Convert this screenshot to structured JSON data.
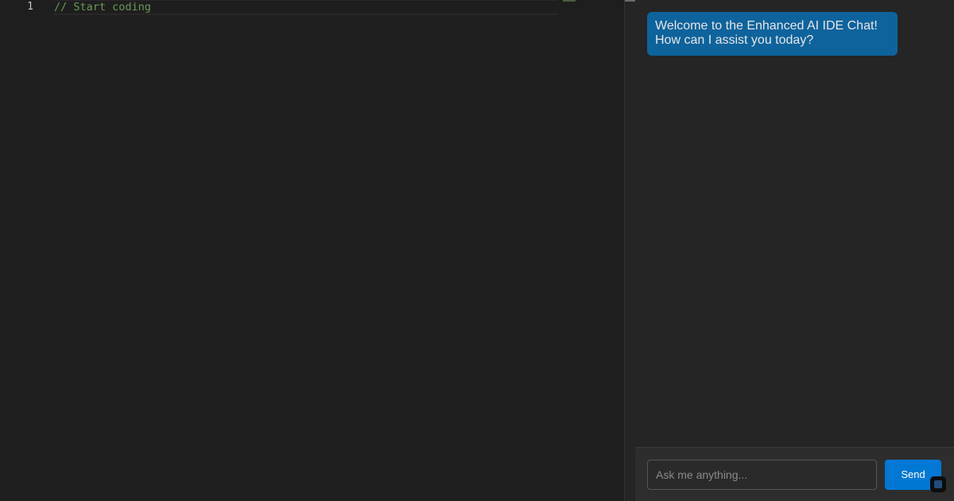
{
  "editor": {
    "lines": [
      {
        "number": "1",
        "text": "// Start coding"
      }
    ]
  },
  "chat": {
    "messages": [
      {
        "role": "assistant",
        "text": "Welcome to the Enhanced AI IDE Chat! How can I assist you today?"
      }
    ],
    "input": {
      "value": "",
      "placeholder": "Ask me anything..."
    },
    "send_label": "Send"
  },
  "colors": {
    "editor_background": "#1e1e1e",
    "comment": "#6a9955",
    "message_bubble": "#0e639c",
    "send_button": "#0078d4"
  }
}
